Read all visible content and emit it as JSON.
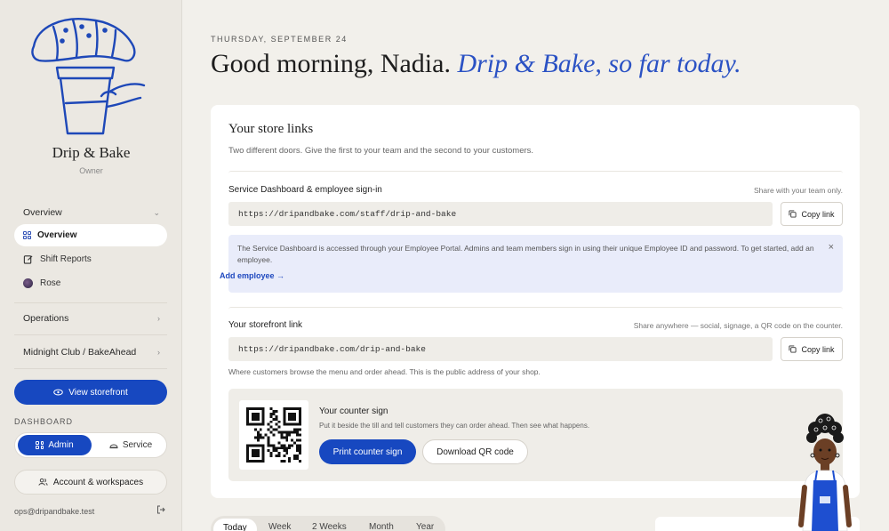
{
  "sidebar": {
    "brand_name": "Drip & Bake",
    "brand_role": "Owner",
    "section_overview": "Overview",
    "items": [
      {
        "label": "Overview"
      },
      {
        "label": "Shift Reports"
      },
      {
        "label": "Rose"
      }
    ],
    "section_operations": "Operations",
    "section_midnight": "Midnight Club / BakeAhead",
    "view_storefront": "View storefront",
    "dashboard_label": "DASHBOARD",
    "toggle_admin": "Admin",
    "toggle_service": "Service",
    "accounts_button": "Account & workspaces",
    "email": "ops@dripandbake.test"
  },
  "main": {
    "date": "THURSDAY, SEPTEMBER 24",
    "greeting": "Good morning, Nadia.",
    "greeting_accent": "Drip & Bake, so far today.",
    "card": {
      "title": "Your store links",
      "subtitle": "Two different doors. Give the first to your team and the second to your customers.",
      "service": {
        "label": "Service Dashboard & employee sign-in",
        "hint": "Share with your team only.",
        "url": "https://dripandbake.com/staff/drip-and-bake",
        "copy": "Copy link"
      },
      "info": {
        "text": "The Service Dashboard is accessed through your Employee Portal. Admins and team members sign in using their unique Employee ID and password. To get started, add an employee.",
        "link": "Add employee →"
      },
      "storefront": {
        "label": "Your storefront link",
        "hint": "Share anywhere — social, signage, a QR code on the counter.",
        "url": "https://dripandbake.com/drip-and-bake",
        "copy": "Copy link",
        "note": "Where customers browse the menu and order ahead. This is the public address of your shop."
      },
      "counter": {
        "title": "Your counter sign",
        "desc": "Put it beside the till and tell customers they can order ahead. Then see what happens.",
        "print": "Print counter sign",
        "download": "Download QR code"
      }
    },
    "range_tabs": [
      "Today",
      "Week",
      "2 Weeks",
      "Month",
      "Year"
    ]
  },
  "colors": {
    "accent": "#1748c0",
    "greeting_accent": "#2b52c4",
    "info_bg": "#e9ecfa"
  },
  "icons": [
    "croissant-cup-logo",
    "grid-icon",
    "report-icon",
    "avatar",
    "chevron-down-icon",
    "chevron-right-icon",
    "eye-icon",
    "cloche-icon",
    "users-icon",
    "logout-icon",
    "copy-icon",
    "close-icon",
    "qr-code"
  ]
}
